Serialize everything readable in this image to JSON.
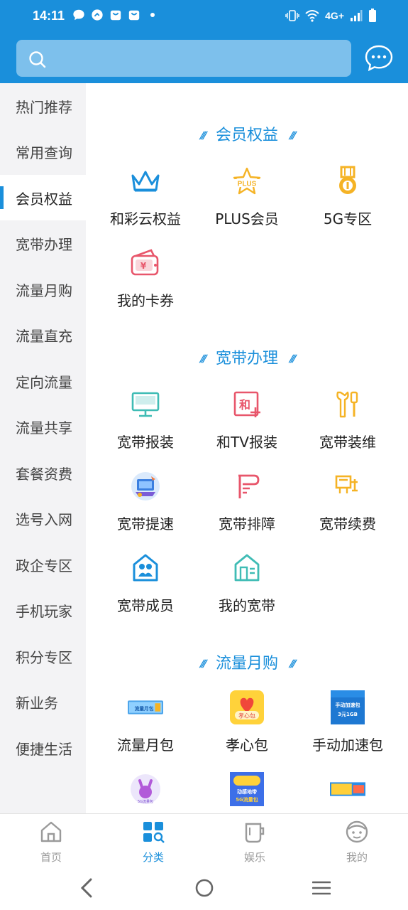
{
  "status_bar": {
    "time": "14:11",
    "network": "4G+"
  },
  "colors": {
    "brand": "#1a8fdb",
    "sidebar_bg": "#f3f3f5"
  },
  "search": {
    "placeholder": ""
  },
  "sidebar": {
    "items": [
      {
        "label": "热门推荐"
      },
      {
        "label": "常用查询"
      },
      {
        "label": "会员权益",
        "active": true
      },
      {
        "label": "宽带办理"
      },
      {
        "label": "流量月购"
      },
      {
        "label": "流量直充"
      },
      {
        "label": "定向流量"
      },
      {
        "label": "流量共享"
      },
      {
        "label": "套餐资费"
      },
      {
        "label": "选号入网"
      },
      {
        "label": "政企专区"
      },
      {
        "label": "手机玩家"
      },
      {
        "label": "积分专区"
      },
      {
        "label": "新业务"
      },
      {
        "label": "便捷生活"
      }
    ]
  },
  "sections": [
    {
      "title": "会员权益",
      "items": [
        {
          "label": "和彩云权益",
          "icon": "crown-icon"
        },
        {
          "label": "PLUS会员",
          "icon": "plus-star-icon"
        },
        {
          "label": "5G专区",
          "icon": "medal-icon"
        },
        {
          "label": "我的卡券",
          "icon": "coupon-wallet-icon"
        }
      ]
    },
    {
      "title": "宽带办理",
      "items": [
        {
          "label": "宽带报装",
          "icon": "monitor-icon"
        },
        {
          "label": "和TV报装",
          "icon": "tv-plus-icon"
        },
        {
          "label": "宽带装维",
          "icon": "wrench-screwdriver-icon"
        },
        {
          "label": "宽带提速",
          "icon": "speedup-illustration-icon"
        },
        {
          "label": "宽带排障",
          "icon": "fault-tool-icon"
        },
        {
          "label": "宽带续费",
          "icon": "plug-renew-icon"
        },
        {
          "label": "宽带成员",
          "icon": "family-house-icon"
        },
        {
          "label": "我的宽带",
          "icon": "house-icon"
        }
      ]
    },
    {
      "title": "流量月购",
      "items": [
        {
          "label": "流量月包",
          "icon": "flow-banner-icon",
          "image_text": "流量月包"
        },
        {
          "label": "孝心包",
          "icon": "heart-gift-icon",
          "image_text": "孝心包"
        },
        {
          "label": "手动加速包",
          "icon": "speed-pack-icon",
          "image_text": "手动加速包 3元1GB"
        },
        {
          "label": "",
          "icon": "5g-rabbit-icon",
          "image_text": "5G流量包"
        },
        {
          "label": "",
          "icon": "dongganzone-5g-pack-icon",
          "image_text": "动感地带 5G流量包"
        },
        {
          "label": "",
          "icon": "banner-pack-icon",
          "image_text": ""
        }
      ]
    }
  ],
  "tabbar": {
    "tabs": [
      {
        "label": "首页",
        "icon": "home-icon"
      },
      {
        "label": "分类",
        "icon": "category-icon",
        "active": true
      },
      {
        "label": "娱乐",
        "icon": "cup-icon"
      },
      {
        "label": "我的",
        "icon": "face-icon"
      }
    ]
  },
  "navbar": {
    "buttons": [
      "back",
      "home",
      "recents"
    ]
  }
}
